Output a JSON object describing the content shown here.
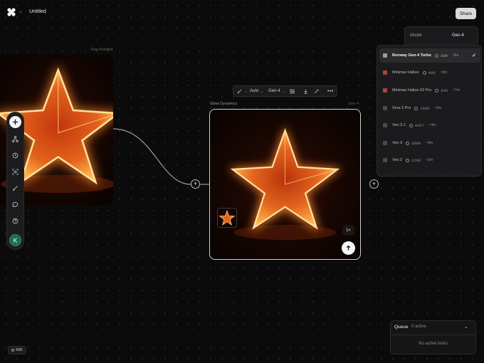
{
  "header": {
    "title": "Untitled",
    "share_label": "Share"
  },
  "left_node": {
    "model": "Flux Kontext"
  },
  "center_node": {
    "title": "Glow Dynamics",
    "model": "Gen-4",
    "count": "1×"
  },
  "node_toolbar": {
    "aspect": "Auto",
    "model": "Gen-4"
  },
  "model_select": {
    "label": "Model",
    "value": "Gen-4"
  },
  "models": [
    {
      "name": "Runway Gen-4 Turbo",
      "credits": "334",
      "time": "~1s",
      "selected": true,
      "icon_color": "#9a9a9a"
    },
    {
      "name": "Minimax Hailuo",
      "credits": "400",
      "time": "~3m",
      "selected": false,
      "icon_color": "#b0413e"
    },
    {
      "name": "Minimax Hailuo 02 Pro",
      "credits": "840",
      "time": "~7m",
      "selected": false,
      "icon_color": "#b0413e"
    },
    {
      "name": "Sora 2 Pro",
      "credits": "1600",
      "time": "~5m",
      "selected": false,
      "icon_color": "#4a4a4a"
    },
    {
      "name": "Veo 3.1",
      "credits": "4267",
      "time": "~4m",
      "selected": false,
      "icon_color": "#4a4a4a"
    },
    {
      "name": "Veo 3",
      "credits": "3000",
      "time": "~4m",
      "selected": false,
      "icon_color": "#4a4a4a"
    },
    {
      "name": "Veo 2",
      "credits": "1200",
      "time": "~3m",
      "selected": false,
      "icon_color": "#4a4a4a"
    }
  ],
  "queue": {
    "title": "Queue",
    "count": "0 active",
    "empty": "No active tasks"
  },
  "credits": {
    "value": "666"
  },
  "user": {
    "initial": "K"
  },
  "colors": {
    "accent": "#f5f5f5",
    "avatar": "#1f6b4e",
    "star_glow": "#ff9a3c"
  }
}
